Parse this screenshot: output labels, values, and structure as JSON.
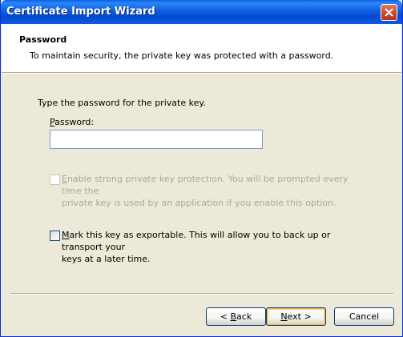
{
  "window": {
    "title": "Certificate Import Wizard",
    "close_icon": "close-icon"
  },
  "header": {
    "title": "Password",
    "subtitle": "To maintain security, the private key was protected with a password."
  },
  "body": {
    "prompt": "Type the password for the private key.",
    "password_label_mnemonic": "P",
    "password_label_rest": "assword:",
    "password_value": "",
    "strong_protection": {
      "checked": false,
      "enabled": false,
      "mnemonic": "E",
      "line1_rest": "nable strong private key protection. You will be prompted every time the",
      "line2": "private key is used by an application if you enable this option."
    },
    "exportable": {
      "checked": false,
      "enabled": true,
      "mnemonic": "M",
      "line1_rest": "ark this key as exportable. This will allow you to back up or transport your",
      "line2": "keys at a later time."
    }
  },
  "buttons": {
    "back_prefix": "< ",
    "back_mnemonic": "B",
    "back_rest": "ack",
    "next_mnemonic": "N",
    "next_rest": "ext >",
    "cancel": "Cancel"
  }
}
